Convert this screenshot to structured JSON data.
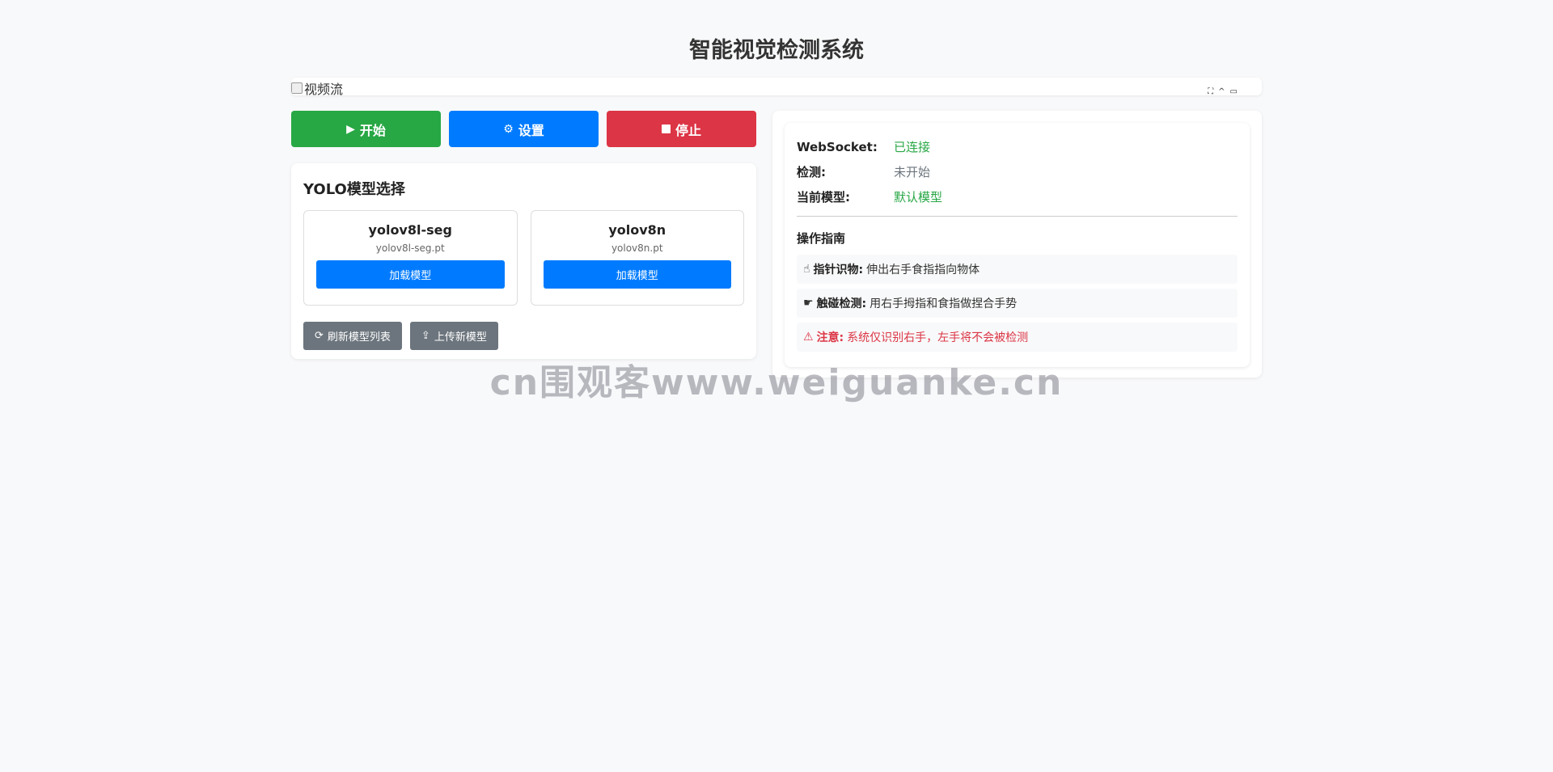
{
  "page": {
    "title": "智能视觉检测系统"
  },
  "video": {
    "alt_text": "视频流",
    "controls": [
      "⛶",
      "^",
      "▭"
    ]
  },
  "controls": {
    "start_label": "开始",
    "settings_label": "设置",
    "stop_label": "停止"
  },
  "models": {
    "title": "YOLO模型选择",
    "items": [
      {
        "name": "yolov8l-seg",
        "file": "yolov8l-seg.pt",
        "button": "加载模型"
      },
      {
        "name": "yolov8n",
        "file": "yolov8n.pt",
        "button": "加载模型"
      }
    ],
    "refresh_label": "刷新模型列表",
    "upload_label": "上传新模型"
  },
  "status": {
    "websocket_label": "WebSocket:",
    "websocket_value": "已连接",
    "detection_label": "检测:",
    "detection_value": "未开始",
    "model_label": "当前模型:",
    "model_value": "默认模型"
  },
  "guide": {
    "title": "操作指南",
    "items": [
      {
        "icon": "☝",
        "label": "指针识物:",
        "text": "伸出右手食指指向物体"
      },
      {
        "icon": "☛",
        "label": "触碰检测:",
        "text": "用右手拇指和食指做捏合手势"
      },
      {
        "icon": "⚠",
        "label": "注意:",
        "text": "系统仅识别右手，左手将不会被检测"
      }
    ]
  },
  "colors": {
    "success": "#28a745",
    "primary": "#007bff",
    "danger": "#dc3545",
    "secondary": "#6c757d",
    "muted": "#6c757d"
  },
  "watermark": "cn围观客www.weiguanke.cn"
}
